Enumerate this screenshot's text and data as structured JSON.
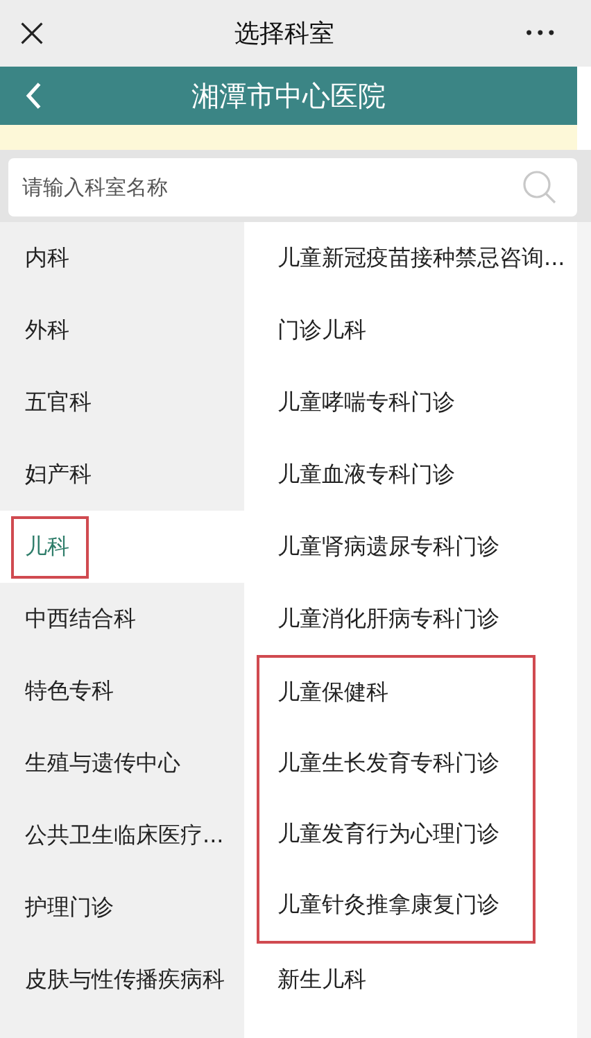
{
  "top_bar": {
    "title": "选择科室",
    "more": "•••"
  },
  "header": {
    "title": "湘潭市中心医院"
  },
  "search": {
    "placeholder": "请输入科室名称"
  },
  "categories": [
    {
      "label": "内科",
      "selected": false,
      "marked": false
    },
    {
      "label": "外科",
      "selected": false,
      "marked": false
    },
    {
      "label": "五官科",
      "selected": false,
      "marked": false
    },
    {
      "label": "妇产科",
      "selected": false,
      "marked": false
    },
    {
      "label": "儿科",
      "selected": true,
      "marked": true
    },
    {
      "label": "中西结合科",
      "selected": false,
      "marked": false
    },
    {
      "label": "特色专科",
      "selected": false,
      "marked": false
    },
    {
      "label": "生殖与遗传中心",
      "selected": false,
      "marked": false
    },
    {
      "label": "公共卫生临床医疗...",
      "selected": false,
      "marked": false
    },
    {
      "label": "护理门诊",
      "selected": false,
      "marked": false
    },
    {
      "label": "皮肤与性传播疾病科",
      "selected": false,
      "marked": false
    }
  ],
  "departments": [
    {
      "label": "儿童新冠疫苗接种禁忌咨询...",
      "marked": false
    },
    {
      "label": "门诊儿科",
      "marked": false
    },
    {
      "label": "儿童哮喘专科门诊",
      "marked": false
    },
    {
      "label": "儿童血液专科门诊",
      "marked": false
    },
    {
      "label": "儿童肾病遗尿专科门诊",
      "marked": false
    },
    {
      "label": "儿童消化肝病专科门诊",
      "marked": false
    },
    {
      "label": "儿童保健科",
      "marked": true
    },
    {
      "label": "儿童生长发育专科门诊",
      "marked": true
    },
    {
      "label": "儿童发育行为心理门诊",
      "marked": true
    },
    {
      "label": "儿童针灸推拿康复门诊",
      "marked": true
    },
    {
      "label": "新生儿科",
      "marked": false
    }
  ]
}
